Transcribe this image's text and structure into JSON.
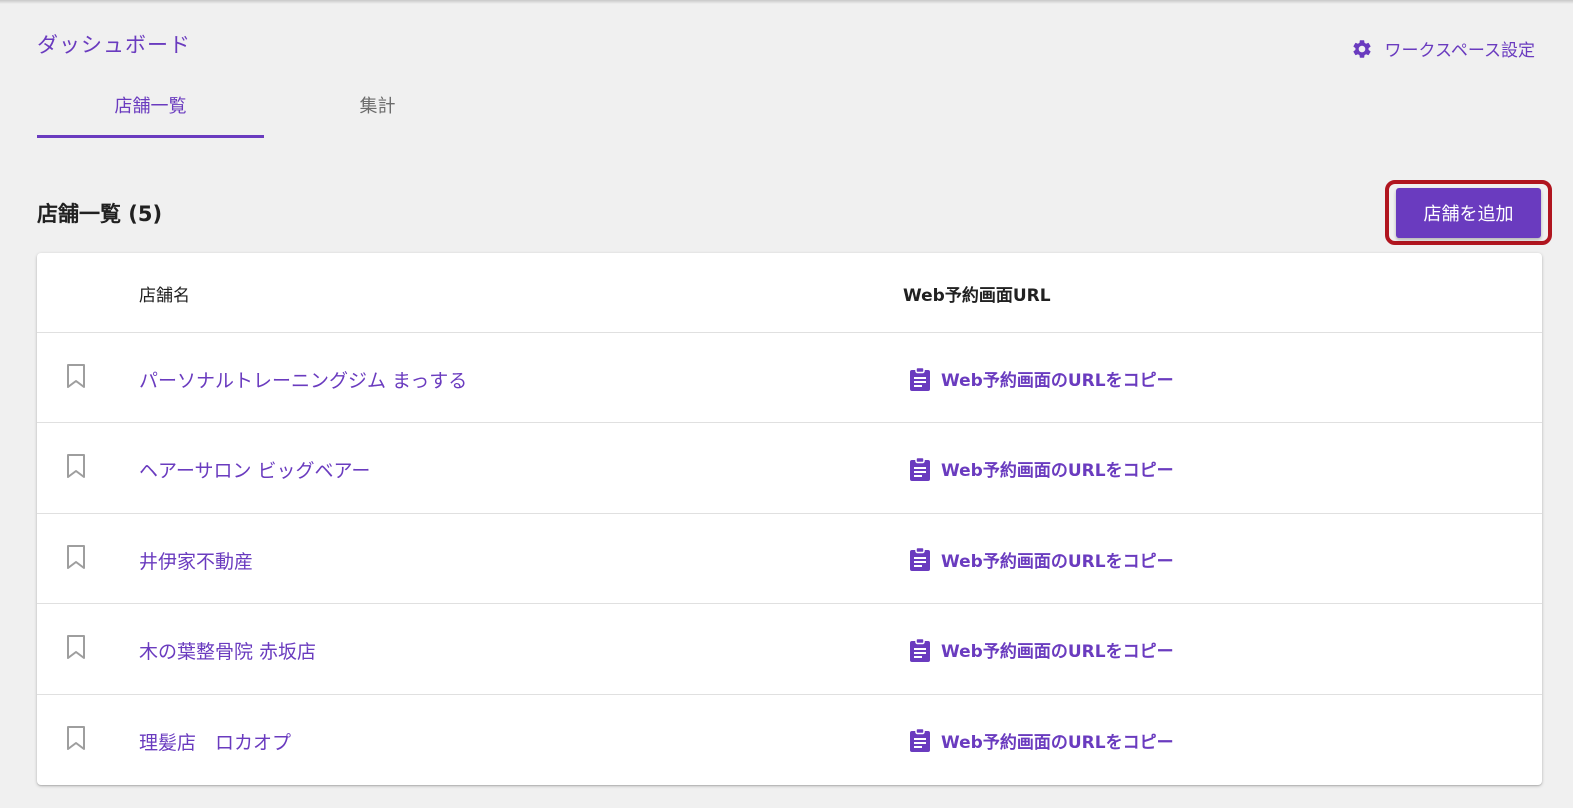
{
  "header": {
    "breadcrumb": "ダッシュボード",
    "workspace_settings": "ワークスペース設定",
    "workspace_settings_icon": "gear-icon"
  },
  "tabs": [
    {
      "label": "店舗一覧",
      "active": true
    },
    {
      "label": "集計",
      "active": false
    }
  ],
  "section": {
    "title": "店舗一覧 (5)",
    "add_button": "店舗を追加"
  },
  "table": {
    "columns": [
      "店舗名",
      "Web予約画面URL"
    ],
    "rows": [
      {
        "name": "パーソナルトレーニングジム まっする",
        "copy_label": "Web予約画面のURLをコピー"
      },
      {
        "name": "ヘアーサロン ビッグベアー",
        "copy_label": "Web予約画面のURLをコピー"
      },
      {
        "name": "井伊家不動産",
        "copy_label": "Web予約画面のURLをコピー"
      },
      {
        "name": "木の葉整骨院 赤坂店",
        "copy_label": "Web予約画面のURLをコピー"
      },
      {
        "name": "理髪店　ロカオプ",
        "copy_label": "Web予約画面のURLをコピー"
      }
    ],
    "row_icons": {
      "bookmark": "bookmark-outline-icon",
      "copy": "clipboard-icon"
    }
  },
  "colors": {
    "accent": "#6a3bbf",
    "highlight_border": "#b0151f",
    "background": "#f0f0f0"
  }
}
